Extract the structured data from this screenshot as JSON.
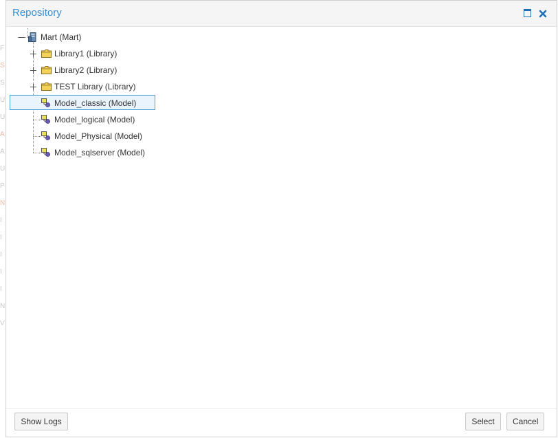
{
  "dialog": {
    "title": "Repository",
    "maximize_label": "Maximize",
    "close_label": "Close"
  },
  "tree": {
    "root": {
      "label": "Mart (Mart)",
      "icon": "database-icon"
    },
    "children": [
      {
        "label": "Library1 (Library)",
        "icon": "folder-icon",
        "expandable": true
      },
      {
        "label": "Library2 (Library)",
        "icon": "folder-icon",
        "expandable": true
      },
      {
        "label": "TEST Library (Library)",
        "icon": "folder-icon",
        "expandable": true
      },
      {
        "label": "Model_classic (Model)",
        "icon": "model-icon",
        "selected": true
      },
      {
        "label": "Model_logical (Model)",
        "icon": "model-icon"
      },
      {
        "label": "Model_Physical (Model)",
        "icon": "model-icon"
      },
      {
        "label": "Model_sqlserver (Model)",
        "icon": "model-icon"
      }
    ]
  },
  "footer": {
    "show_logs_label": "Show Logs",
    "select_label": "Select",
    "cancel_label": "Cancel"
  },
  "colors": {
    "title": "#3a8fd0",
    "selection_fill": "#e9f4fd",
    "selection_border": "#4b9fd5",
    "folder": "#f3d25a"
  }
}
